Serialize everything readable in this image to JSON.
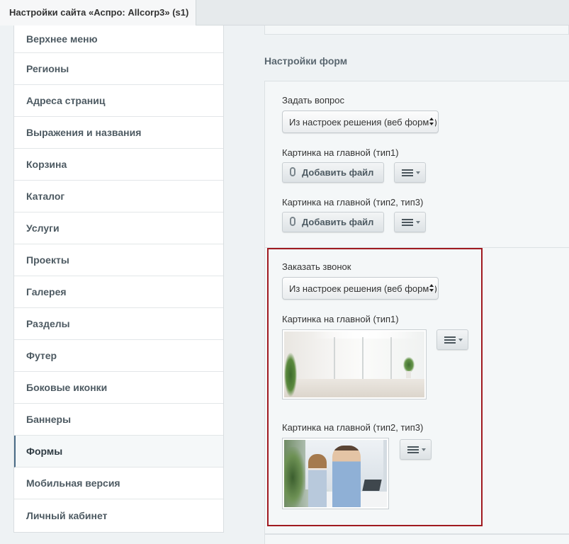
{
  "tab": {
    "title": "Настройки сайта «Аспро: Allcorp3» (s1)"
  },
  "sidebar": {
    "items": [
      {
        "label": "Верхнее меню"
      },
      {
        "label": "Регионы"
      },
      {
        "label": "Адреса страниц"
      },
      {
        "label": "Выражения и названия"
      },
      {
        "label": "Корзина"
      },
      {
        "label": "Каталог"
      },
      {
        "label": "Услуги"
      },
      {
        "label": "Проекты"
      },
      {
        "label": "Галерея"
      },
      {
        "label": "Разделы"
      },
      {
        "label": "Футер"
      },
      {
        "label": "Боковые иконки"
      },
      {
        "label": "Баннеры"
      },
      {
        "label": "Формы",
        "active": true
      },
      {
        "label": "Мобильная версия"
      },
      {
        "label": "Личный кабинет"
      }
    ]
  },
  "forms": {
    "section_title": "Настройки форм",
    "ask": {
      "label": "Задать вопрос",
      "select_value": "Из настроек решения (веб форма)",
      "image1_label": "Картинка на главной (тип1)",
      "image2_label": "Картинка на главной (тип2, тип3)",
      "add_file_label": "Добавить файл"
    },
    "callback": {
      "label": "Заказать звонок",
      "select_value": "Из настроек решения (веб форма)",
      "image1_label": "Картинка на главной (тип1)",
      "image2_label": "Картинка на главной (тип2, тип3)"
    }
  },
  "colors": {
    "highlight_border": "#a01a20",
    "active_marker": "#4a6b86"
  },
  "icons": [
    "paperclip-icon",
    "menu-icon",
    "caret-down-icon",
    "select-arrows-icon"
  ]
}
